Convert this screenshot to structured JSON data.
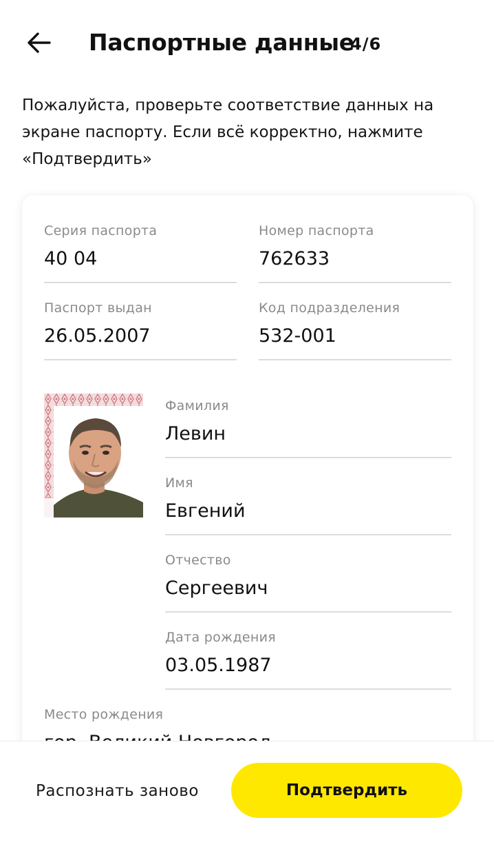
{
  "header": {
    "title": "Паспортные данные",
    "step": "4/6"
  },
  "instructions": "Пожалуйста, проверьте соответствие данных на экране паспорту. Если всё корректно, нажмите «Подтвердить»",
  "passport": {
    "series": {
      "label": "Серия паспорта",
      "value": "40 04"
    },
    "number": {
      "label": "Номер паспорта",
      "value": "762633"
    },
    "issued": {
      "label": "Паспорт выдан",
      "value": "26.05.2007"
    },
    "division_code": {
      "label": "Код подразделения",
      "value": "532-001"
    },
    "surname": {
      "label": "Фамилия",
      "value": "Левин"
    },
    "name": {
      "label": "Имя",
      "value": "Евгений"
    },
    "patronymic": {
      "label": "Отчество",
      "value": "Сергеевич"
    },
    "birth_date": {
      "label": "Дата рождения",
      "value": "03.05.1987"
    },
    "birth_place": {
      "label": "Место рождения",
      "value": "гор. Великий Новгород"
    }
  },
  "actions": {
    "rescan_label": "Распознать заново",
    "confirm_label": "Подтвердить"
  },
  "colors": {
    "accent": "#ffe800",
    "label_gray": "#8a8a8a",
    "divider": "#dcdcdc"
  },
  "icons": {
    "back": "arrow-left-icon"
  }
}
